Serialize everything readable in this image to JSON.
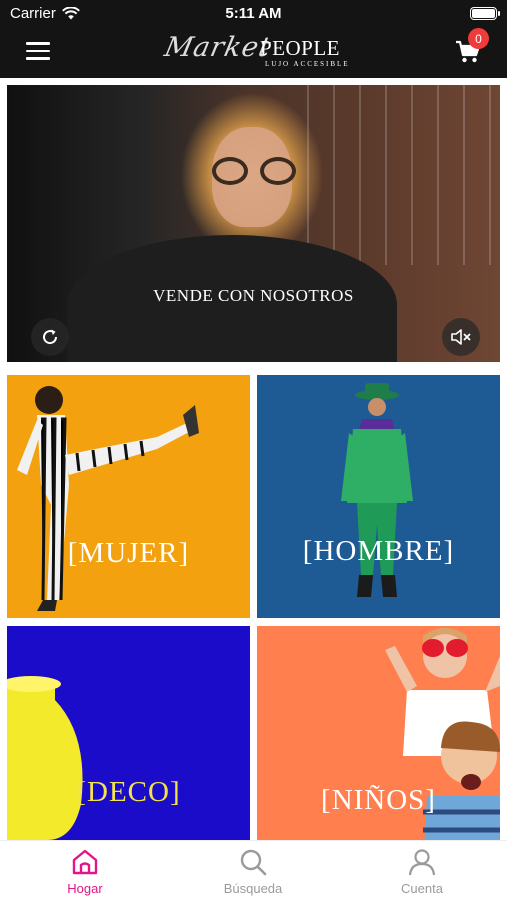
{
  "status_bar": {
    "carrier": "Carrier",
    "time": "5:11 AM"
  },
  "header": {
    "logo_script": "Market",
    "logo_brand": "PEOPLE",
    "logo_tagline": "LUJO ACCESIBLE",
    "cart_count": "0"
  },
  "hero": {
    "caption": "VENDE CON NOSOTROS"
  },
  "categories": [
    {
      "label": "[MUJER]",
      "color": "#f3a10f"
    },
    {
      "label": "[HOMBRE]",
      "color": "#1e5b94"
    },
    {
      "label": "[DECO]",
      "color": "#1a0cc8"
    },
    {
      "label": "[NIÑOS]",
      "color": "#ff7f4e"
    }
  ],
  "tabbar": {
    "items": [
      {
        "label": "Hogar",
        "icon": "home-icon",
        "active": true
      },
      {
        "label": "Búsqueda",
        "icon": "search-icon",
        "active": false
      },
      {
        "label": "Cuenta",
        "icon": "user-icon",
        "active": false
      }
    ],
    "active_color": "#e0168a"
  }
}
